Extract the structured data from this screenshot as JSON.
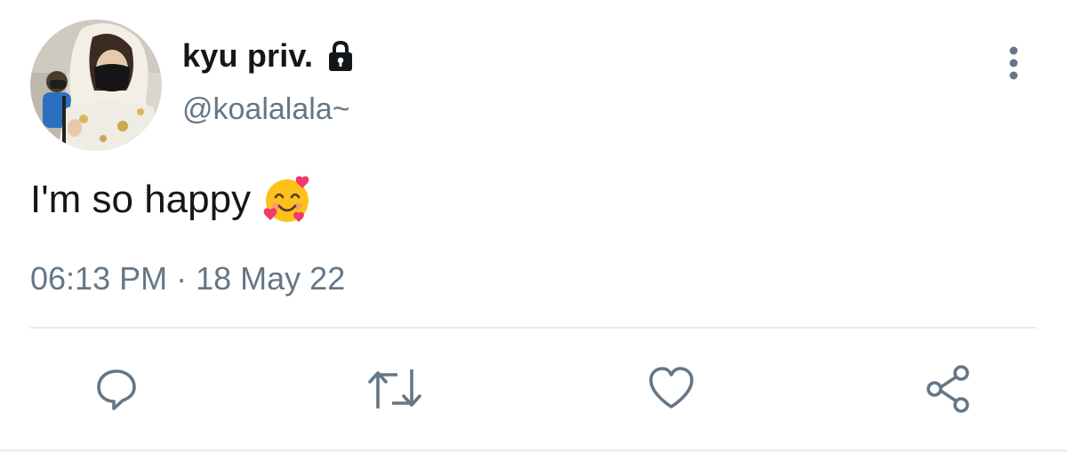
{
  "user": {
    "display_name": "kyu priv.",
    "handle": "@koalalala~",
    "protected_icon": "lock-icon",
    "avatar": "avatar-photo"
  },
  "tweet": {
    "text": "I'm so happy",
    "emoji": "smiling-face-with-hearts-emoji",
    "time": "06:13 PM",
    "separator": "·",
    "date": "18 May 22"
  },
  "actions": {
    "reply": "reply-icon",
    "retweet": "retweet-icon",
    "like": "heart-icon",
    "share": "share-icon"
  },
  "menu": {
    "icon": "more-vertical-icon"
  },
  "colors": {
    "text": "#14171a",
    "secondary": "#657786",
    "divider": "#e6ecf0",
    "background": "#ffffff"
  }
}
